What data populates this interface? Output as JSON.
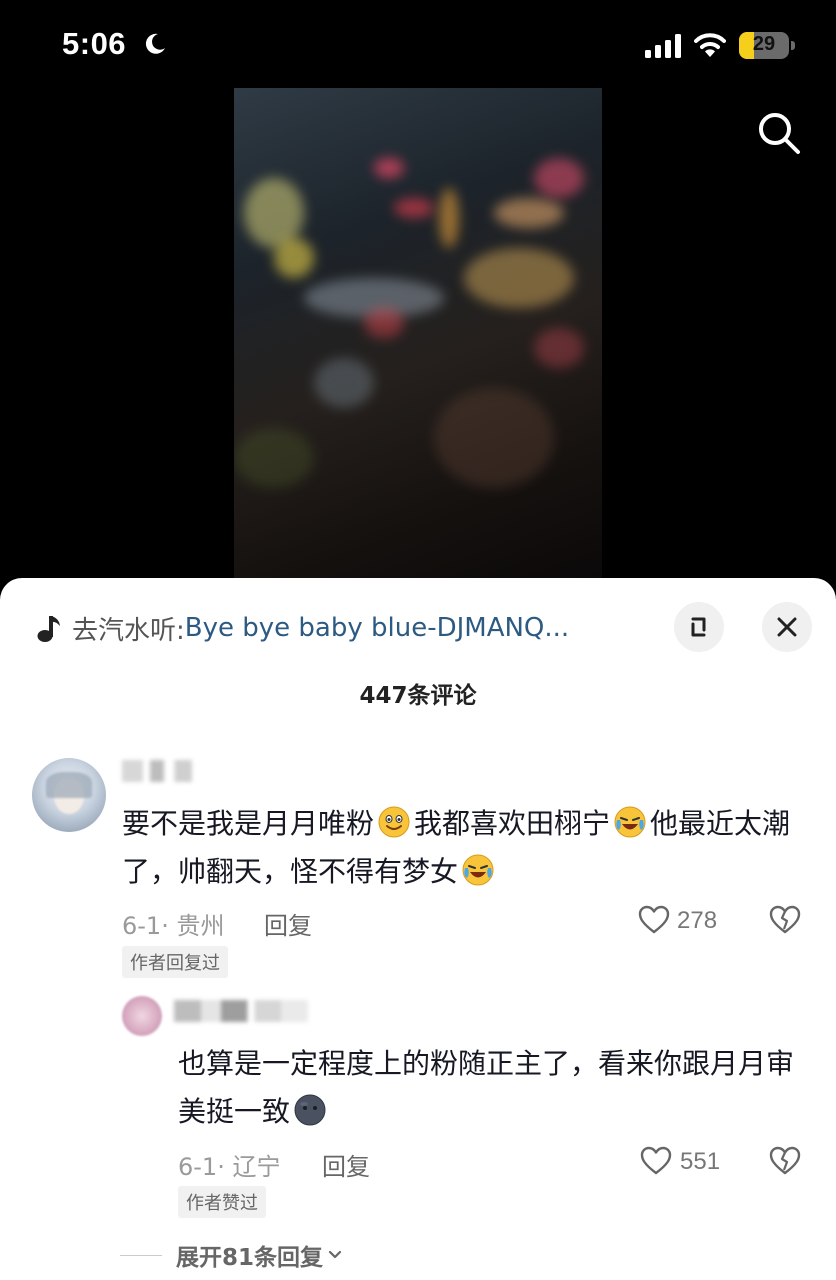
{
  "status_bar": {
    "time": "5:06",
    "battery_level": "29",
    "battery_fraction": 0.29,
    "icons": [
      "moon-icon",
      "cellular-signal-icon",
      "wifi-icon",
      "battery-icon"
    ]
  },
  "top": {
    "search_icon": "search-icon"
  },
  "music": {
    "prefix": "去汽水听: ",
    "title": "Bye bye baby blue-DJMANQ...",
    "icon": "music-note-icon"
  },
  "sheet": {
    "comments_count": "447条评论",
    "expand_icon": "expand-icon",
    "close_icon": "close-icon"
  },
  "comments": [
    {
      "text_before": "要不是我是月月唯粉",
      "text_middle": "我都喜欢田栩宁",
      "text_after": "他最近太潮了，帅翻天，怪不得有梦女",
      "date": "6-1· 贵州",
      "reply_label": "回复",
      "likes": "278",
      "badge": "作者回复过"
    },
    {
      "text": "也算是一定程度上的粉随正主了，看来你跟月月审美挺一致",
      "date": "6-1· 辽宁",
      "reply_label": "回复",
      "likes": "551",
      "badge": "作者赞过"
    }
  ],
  "expand_replies": "展开81条回复",
  "colors": {
    "link": "#2d5a82",
    "battery": "#f5cf1b",
    "background": "#000000"
  }
}
